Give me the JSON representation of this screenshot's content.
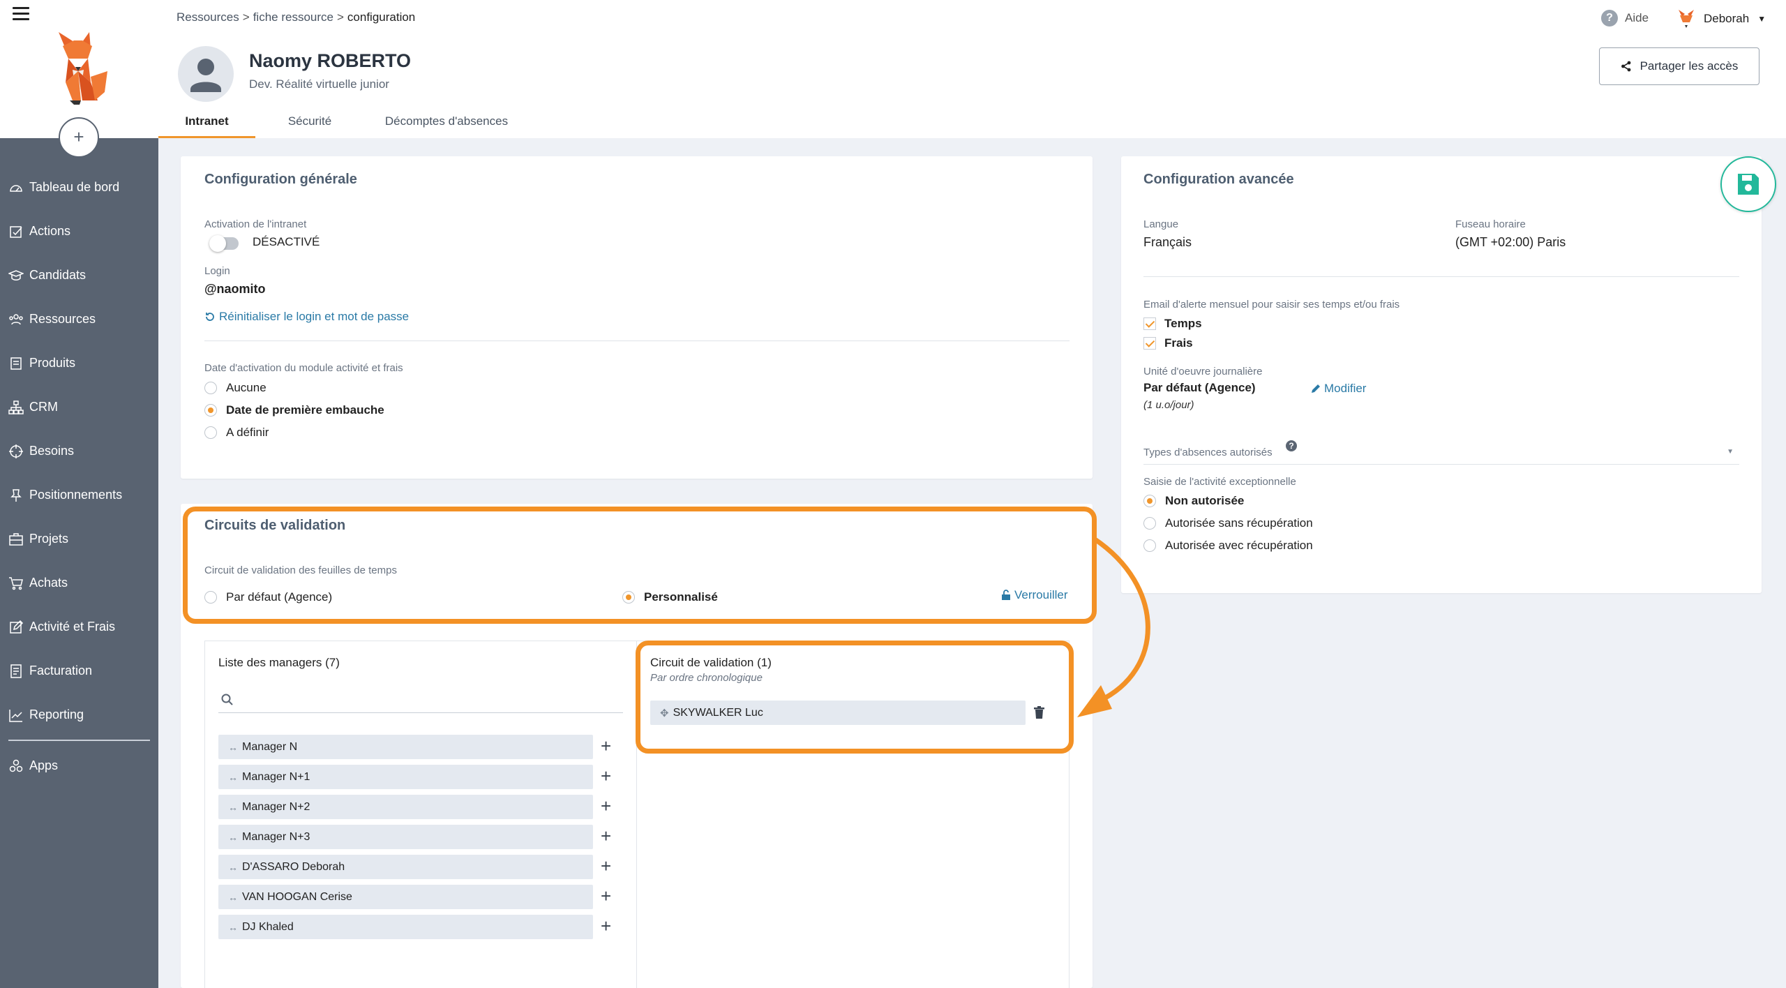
{
  "sidebar": {
    "items": [
      {
        "label": "Tableau de bord",
        "icon": "dashboard-icon"
      },
      {
        "label": "Actions",
        "icon": "actions-icon"
      },
      {
        "label": "Candidats",
        "icon": "graduation-cap-icon"
      },
      {
        "label": "Ressources",
        "icon": "users-icon"
      },
      {
        "label": "Produits",
        "icon": "product-icon"
      },
      {
        "label": "CRM",
        "icon": "sitemap-icon"
      },
      {
        "label": "Besoins",
        "icon": "target-icon"
      },
      {
        "label": "Positionnements",
        "icon": "pin-icon"
      },
      {
        "label": "Projets",
        "icon": "briefcase-icon"
      },
      {
        "label": "Achats",
        "icon": "cart-icon"
      },
      {
        "label": "Activité et Frais",
        "icon": "edit-icon"
      },
      {
        "label": "Facturation",
        "icon": "invoice-icon"
      },
      {
        "label": "Reporting",
        "icon": "chart-icon"
      },
      {
        "label": "Apps",
        "icon": "apps-icon"
      }
    ],
    "add_label": "+"
  },
  "header": {
    "breadcrumb": [
      "Ressources",
      "fiche ressource",
      "configuration"
    ],
    "breadcrumb_sep": ">",
    "help_label": "Aide",
    "user_name": "Deborah",
    "person_name": "Naomy ROBERTO",
    "person_role": "Dev. Réalité virtuelle junior",
    "share_label": "Partager les accès",
    "tabs": [
      {
        "label": "Intranet",
        "active": true
      },
      {
        "label": "Sécurité",
        "active": false
      },
      {
        "label": "Décomptes d'absences",
        "active": false
      }
    ]
  },
  "general": {
    "title": "Configuration générale",
    "intranet_label": "Activation de l'intranet",
    "intranet_state": "DÉSACTIVÉ",
    "login_label": "Login",
    "login_value": "@naomito",
    "reset_link": "Réinitialiser le login et mot de passe",
    "activation_label": "Date d'activation du module activité et frais",
    "activation_options": [
      "Aucune",
      "Date de première embauche",
      "A définir"
    ],
    "activation_selected": 1
  },
  "circuits": {
    "title": "Circuits de validation",
    "timesheet_label": "Circuit de validation des feuilles de temps",
    "option_default": "Par défaut (Agence)",
    "option_custom": "Personnalisé",
    "lock_link": "Verrouiller",
    "managers_title": "Liste des managers (7)",
    "managers": [
      "Manager N",
      "Manager N+1",
      "Manager N+2",
      "Manager N+3",
      "D'ASSARO Deborah",
      "VAN HOOGAN Cerise",
      "DJ Khaled"
    ],
    "circuit_title": "Circuit de validation (1)",
    "circuit_subtitle": "Par ordre chronologique",
    "circuit_items": [
      "SKYWALKER Luc"
    ],
    "add_symbol": "+"
  },
  "advanced": {
    "title": "Configuration avancée",
    "language_label": "Langue",
    "language_value": "Français",
    "timezone_label": "Fuseau horaire",
    "timezone_value": "(GMT +02:00) Paris",
    "alert_label": "Email d'alerte mensuel pour saisir ses temps et/ou frais",
    "alert_options": [
      "Temps",
      "Frais"
    ],
    "unit_label": "Unité d'oeuvre journalière",
    "unit_value": "Par défaut (Agence)",
    "unit_sub": "(1 u.o/jour)",
    "modify_link": "Modifier",
    "absence_types_label": "Types d'absences autorisés",
    "exceptional_label": "Saisie de l'activité exceptionnelle",
    "exceptional_options": [
      "Non autorisée",
      "Autorisée sans récupération",
      "Autorisée avec récupération"
    ],
    "exceptional_selected": 0
  },
  "colors": {
    "accent": "#f0962c",
    "highlight": "#f39125",
    "sidebar": "#596371",
    "link": "#2a7aa6",
    "save": "#22b89a"
  }
}
